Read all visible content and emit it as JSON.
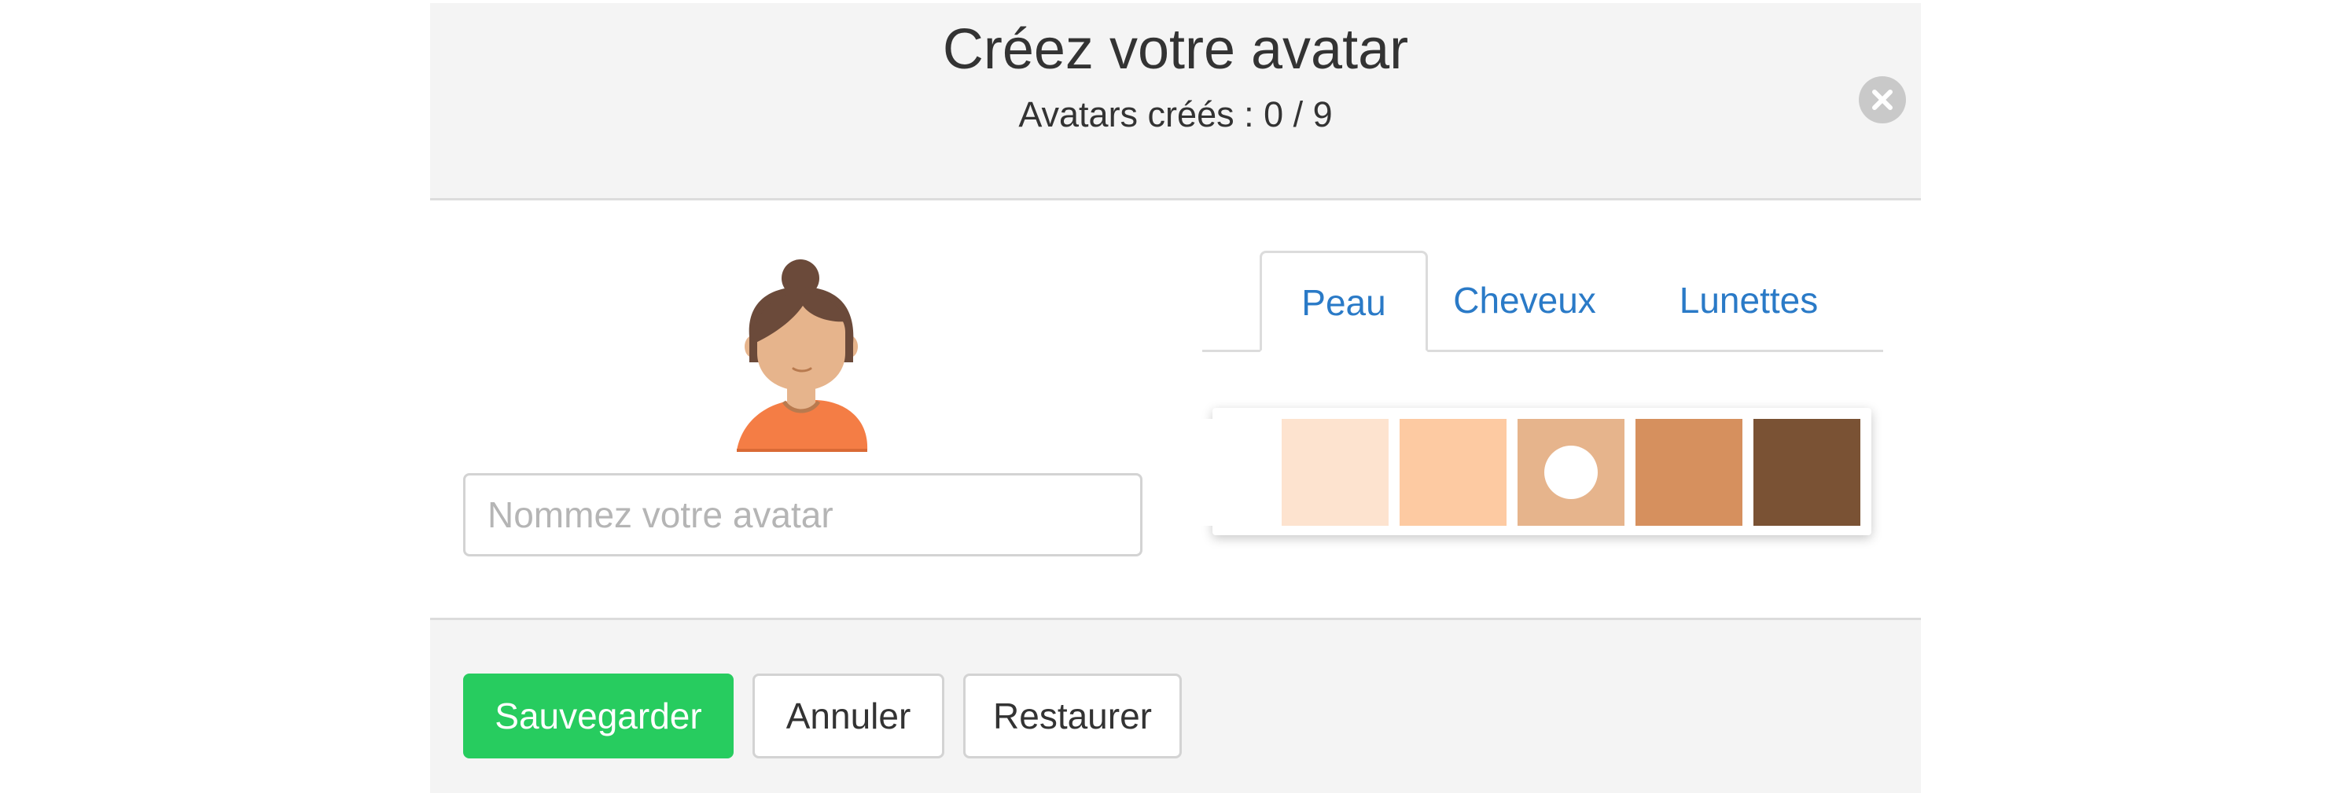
{
  "header": {
    "title": "Créez votre avatar",
    "subtitle": "Avatars créés : 0 / 9",
    "close_icon": "close-icon"
  },
  "avatar": {
    "icon": "avatar-preview",
    "name_placeholder": "Nommez votre avatar",
    "name_value": ""
  },
  "tabs": [
    {
      "label": "Peau",
      "active": true
    },
    {
      "label": "Cheveux",
      "active": false
    },
    {
      "label": "Lunettes",
      "active": false
    }
  ],
  "skin_swatches": [
    {
      "color": "#ffffff",
      "selected": false
    },
    {
      "color": "#fde3cf",
      "selected": false
    },
    {
      "color": "#fdcaa2",
      "selected": false
    },
    {
      "color": "#e6b48c",
      "selected": true
    },
    {
      "color": "#d6905e",
      "selected": false
    },
    {
      "color": "#7a5234",
      "selected": false
    }
  ],
  "footer": {
    "save_label": "Sauvegarder",
    "cancel_label": "Annuler",
    "restore_label": "Restaurer"
  },
  "colors": {
    "accent_link": "#2a7ac7",
    "save_green": "#27cc5f",
    "header_bg": "#f4f4f4"
  }
}
